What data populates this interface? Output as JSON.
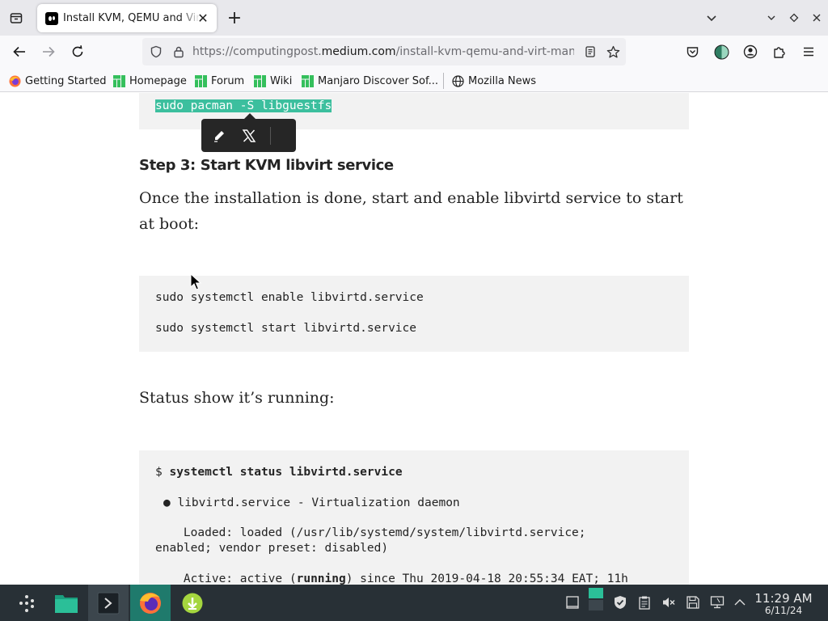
{
  "browser": {
    "tab": {
      "title": "Install KVM, QEMU and Virt Manager on Arch Linux / Manjaro",
      "close": "✕"
    },
    "new_tab": "+",
    "url": {
      "prefix": "https://computingpost.",
      "host": "medium.com",
      "path": "/install-kvm-qemu-and-virt-manager-on-arch-linux-manjaro"
    },
    "bookmarks": [
      {
        "label": "Getting Started",
        "icon": "firefox-icon"
      },
      {
        "label": "Homepage",
        "icon": "manjaro-icon"
      },
      {
        "label": "Forum",
        "icon": "manjaro-icon"
      },
      {
        "label": "Wiki",
        "icon": "manjaro-icon"
      },
      {
        "label": "Manjaro Discover Sof...",
        "icon": "manjaro-icon"
      },
      {
        "label": "Mozilla News",
        "icon": "globe-icon"
      }
    ]
  },
  "article": {
    "top_code": "sudo pacman -S libguestfs",
    "step3_heading": "Step 3: Start KVM libvirt service",
    "step3_text": "Once the installation is done, start and enable libvirtd service to start at boot:",
    "step3_code": [
      "sudo systemctl enable libvirtd.service",
      "sudo systemctl start libvirtd.service"
    ],
    "status_text": "Status show it’s running:",
    "status_code": {
      "prompt": "$ ",
      "command": "systemctl status libvirtd.service",
      "unit_line": "● libvirtd.service - Virtualization daemon",
      "loaded_line1": "    Loaded: loaded (/usr/lib/systemd/system/libvirtd.service;",
      "loaded_line2": "enabled; vendor preset: disabled)",
      "active_prefix": "    Active: active (",
      "active_bold": "running",
      "active_suffix": ") since Thu 2019-04-18 20:55:34 EAT; 11h"
    }
  },
  "taskbar": {
    "time": "11:29 AM",
    "date": "6/11/24"
  },
  "colors": {
    "selection": "#3cbf9e",
    "manjaro_green": "#35bf5c",
    "taskbar": "#283036"
  }
}
